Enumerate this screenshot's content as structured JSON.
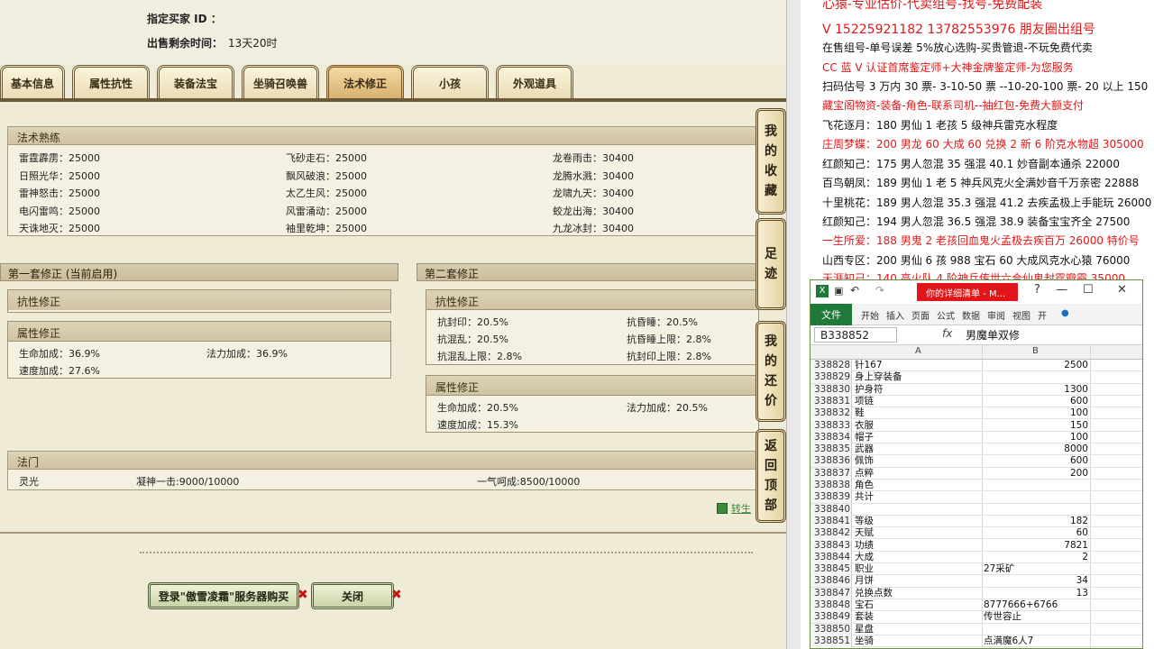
{
  "top_info": {
    "buyer_label": "指定买家 ID ：",
    "remaining_label": "出售剩余时间：",
    "remaining_value": "13天20时"
  },
  "tabs": [
    "基本信息",
    "属性抗性",
    "装备法宝",
    "坐骑召唤兽",
    "法术修正",
    "小孩",
    "外观道具"
  ],
  "active_tab": "法术修正",
  "spell_mastery": {
    "title": "法术熟练",
    "rows": [
      [
        "雷霆霹雳：25000",
        "飞砂走石：25000",
        "龙卷雨击：30400"
      ],
      [
        "日照光华：25000",
        "飘风破浪：25000",
        "龙腾水溅：30400"
      ],
      [
        "雷神怒击：25000",
        "太乙生风：25000",
        "龙啸九天：30400"
      ],
      [
        "电闪雷鸣：25000",
        "风雷涌动：25000",
        "蛟龙出海：30400"
      ],
      [
        "天诛地灭：25000",
        "袖里乾坤：25000",
        "九龙冰封：30400"
      ]
    ]
  },
  "set1": {
    "title": "第一套修正 (当前启用)",
    "resist_title": "抗性修正",
    "attr_title": "属性修正",
    "attr_items": [
      "生命加成：36.9%",
      "法力加成：36.9%",
      "速度加成：27.6%"
    ]
  },
  "set2": {
    "title": "第二套修正",
    "resist_title": "抗性修正",
    "resist_items": [
      "抗封印：20.5%",
      "抗昏睡：20.5%",
      "抗混乱：20.5%",
      "抗昏睡上限：2.8%",
      "抗混乱上限：2.8%",
      "抗封印上限：2.8%"
    ],
    "attr_title": "属性修正",
    "attr_items": [
      "生命加成：20.5%",
      "法力加成：20.5%",
      "速度加成：15.3%"
    ]
  },
  "fa_men": {
    "title": "法门",
    "items": [
      "灵光",
      "凝神一击:9000/10000",
      "一气呵成:8500/10000"
    ]
  },
  "transfer_label": "转生",
  "side_buttons": [
    {
      "label": "我的收藏",
      "chars": [
        "我",
        "的",
        "收",
        "藏"
      ]
    },
    {
      "label": "足迹",
      "chars": [
        "足",
        "迹"
      ]
    },
    {
      "label": "我的还价",
      "chars": [
        "我",
        "的",
        "还",
        "价"
      ]
    },
    {
      "label": "返回顶部",
      "chars": [
        "返",
        "回",
        "顶",
        "部"
      ]
    }
  ],
  "bottom_buttons": {
    "login": "登录\"傲雪凌霜\"服务器购买",
    "close": "关闭"
  },
  "ad": {
    "lines": [
      {
        "text": "心猿-专业估价-代卖组号-找号-免费配装",
        "color": "red"
      },
      {
        "text": "V 15225921182   13782553976 朋友圈出组号",
        "color": "red"
      },
      {
        "text": "在售组号-单号误差 5%放心选购-买贵管退-不玩免费代卖",
        "color": "black"
      },
      {
        "text": "CC 蓝 V 认证首席鉴定师+大神金牌鉴定师-为您服务",
        "color": "red"
      },
      {
        "text": "扫码估号 3 万内 30 票- 3-10-50 票   --10-20-100 票- 20 以上 150",
        "color": "black"
      },
      {
        "text": "藏宝阁物资-装备-角色-联系司机--抽红包-免费大额支付",
        "color": "red"
      },
      {
        "text": "飞花逐月：180 男仙 1 老孩 5 级神兵雷克水程度",
        "color": "black"
      },
      {
        "text": "庄周梦蝶：200 男龙 60 大成 60 兑换 2 新 6 阶克水物超 305000",
        "color": "red"
      },
      {
        "text": "红颜知己：175 男人忽混 35 强混 40.1 妙音副本通杀 22000",
        "color": "black"
      },
      {
        "text": "百鸟朝凤：189 男仙 1 老 5 神兵风克火全满妙音千万亲密 22888",
        "color": "black"
      },
      {
        "text": "十里桃花：189 男人忽混 35.3 强混 41.2 去疾孟极上手能玩 26000",
        "color": "black"
      },
      {
        "text": "红颜知己：194 男人忽混 36.5 强混 38.9 装备宝宝齐全 27500",
        "color": "black"
      },
      {
        "text": "一生所爱：188 男鬼 2 老孩回血鬼火孟极去疾百万 26000 特价号",
        "color": "red"
      },
      {
        "text": "山西专区：200 男仙 6 孩 988 宝石 60 大成风克水心猿 76000",
        "color": "black"
      },
      {
        "text": "天涯知己：140 高火队 4 阶神兵传世六合仙鬼封霆瓣霞 35000",
        "color": "red"
      }
    ]
  },
  "excel": {
    "title": "你的详细清单 - M...",
    "ribbon": [
      "文件",
      "开始",
      "插入",
      "页面",
      "公式",
      "数据",
      "审阅",
      "视图",
      "开"
    ],
    "namebox": "B338852",
    "fx": "fx",
    "formula": "男魔单双修",
    "col_a": "A",
    "col_b": "B",
    "rows": [
      {
        "n": "338828",
        "a": "针167",
        "b": "2500"
      },
      {
        "n": "338829",
        "a": "身上穿装备",
        "b": ""
      },
      {
        "n": "338830",
        "a": "护身符",
        "b": "1300"
      },
      {
        "n": "338831",
        "a": "项链",
        "b": "600"
      },
      {
        "n": "338832",
        "a": "鞋",
        "b": "100"
      },
      {
        "n": "338833",
        "a": "衣服",
        "b": "150"
      },
      {
        "n": "338834",
        "a": "帽子",
        "b": "100"
      },
      {
        "n": "338835",
        "a": "武器",
        "b": "8000"
      },
      {
        "n": "338836",
        "a": "佩饰",
        "b": "600"
      },
      {
        "n": "338837",
        "a": "点粹",
        "b": "200"
      },
      {
        "n": "338838",
        "a": "角色",
        "b": ""
      },
      {
        "n": "338839",
        "a": "共计",
        "b": ""
      },
      {
        "n": "338840",
        "a": "",
        "b": ""
      },
      {
        "n": "338841",
        "a": "等级",
        "b": "182"
      },
      {
        "n": "338842",
        "a": "天赋",
        "b": "60"
      },
      {
        "n": "338843",
        "a": "功绩",
        "b": "7821"
      },
      {
        "n": "338844",
        "a": "大成",
        "b": "2"
      },
      {
        "n": "338845",
        "a": "职业",
        "b": "27采矿"
      },
      {
        "n": "338846",
        "a": "月饼",
        "b": "34"
      },
      {
        "n": "338847",
        "a": "兑换点数",
        "b": "13"
      },
      {
        "n": "338848",
        "a": "宝石",
        "b": "8777666+6766"
      },
      {
        "n": "338849",
        "a": "套装",
        "b": "传世容止"
      },
      {
        "n": "338850",
        "a": "星盘",
        "b": ""
      },
      {
        "n": "338851",
        "a": "坐骑",
        "b": "点满魔6人7"
      }
    ]
  }
}
